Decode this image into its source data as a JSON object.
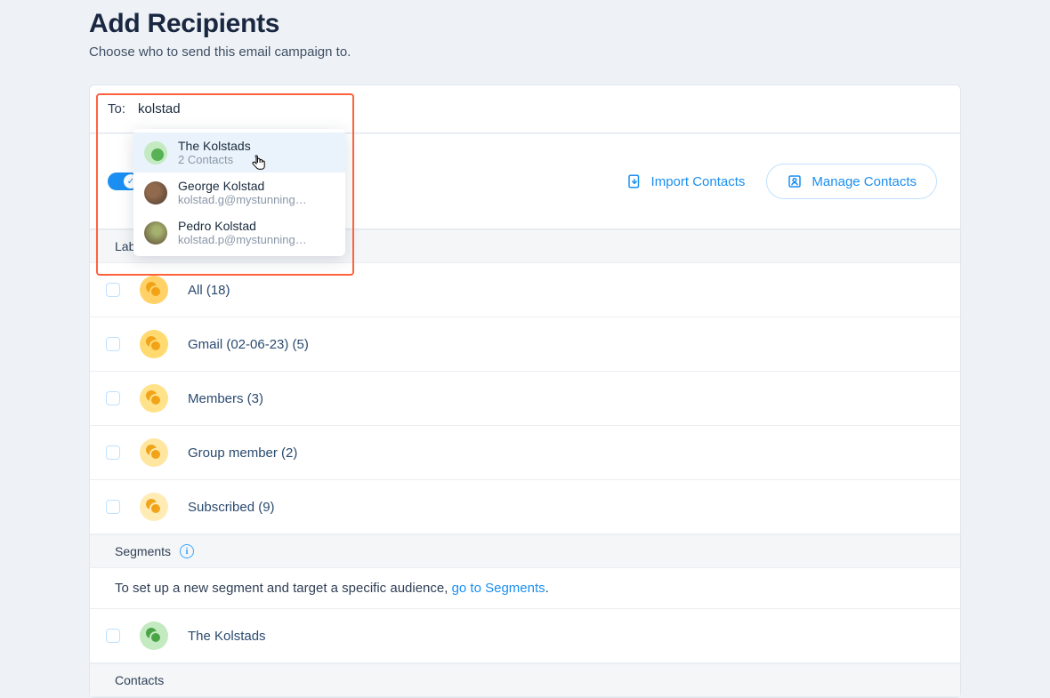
{
  "header": {
    "title": "Add Recipients",
    "subtitle": "Choose who to send this email campaign to."
  },
  "to": {
    "label": "To:",
    "value": "kolstad"
  },
  "autocomplete": [
    {
      "title": "The Kolstads",
      "sub": "2 Contacts",
      "kind": "group",
      "active": true
    },
    {
      "title": "George Kolstad",
      "sub": "kolstad.g@mystunning…",
      "kind": "photo1",
      "active": false
    },
    {
      "title": "Pedro Kolstad",
      "sub": "kolstad.p@mystunning…",
      "kind": "photo2",
      "active": false
    }
  ],
  "toolbar": {
    "import_label": "Import Contacts",
    "manage_label": "Manage Contacts"
  },
  "sections": {
    "labels": "Labels",
    "segments": "Segments",
    "contacts": "Contacts"
  },
  "labels": [
    {
      "text": "All (18)",
      "tone": "y1"
    },
    {
      "text": "Gmail (02-06-23) (5)",
      "tone": "y2"
    },
    {
      "text": "Members (3)",
      "tone": "y3"
    },
    {
      "text": "Group member (2)",
      "tone": "y4"
    },
    {
      "text": "Subscribed (9)",
      "tone": "y5"
    }
  ],
  "segments_help": {
    "prefix": "To set up a new segment and target a specific audience, ",
    "link": "go to Segments",
    "suffix": "."
  },
  "segments": [
    {
      "text": "The Kolstads",
      "tone": "seg"
    }
  ]
}
